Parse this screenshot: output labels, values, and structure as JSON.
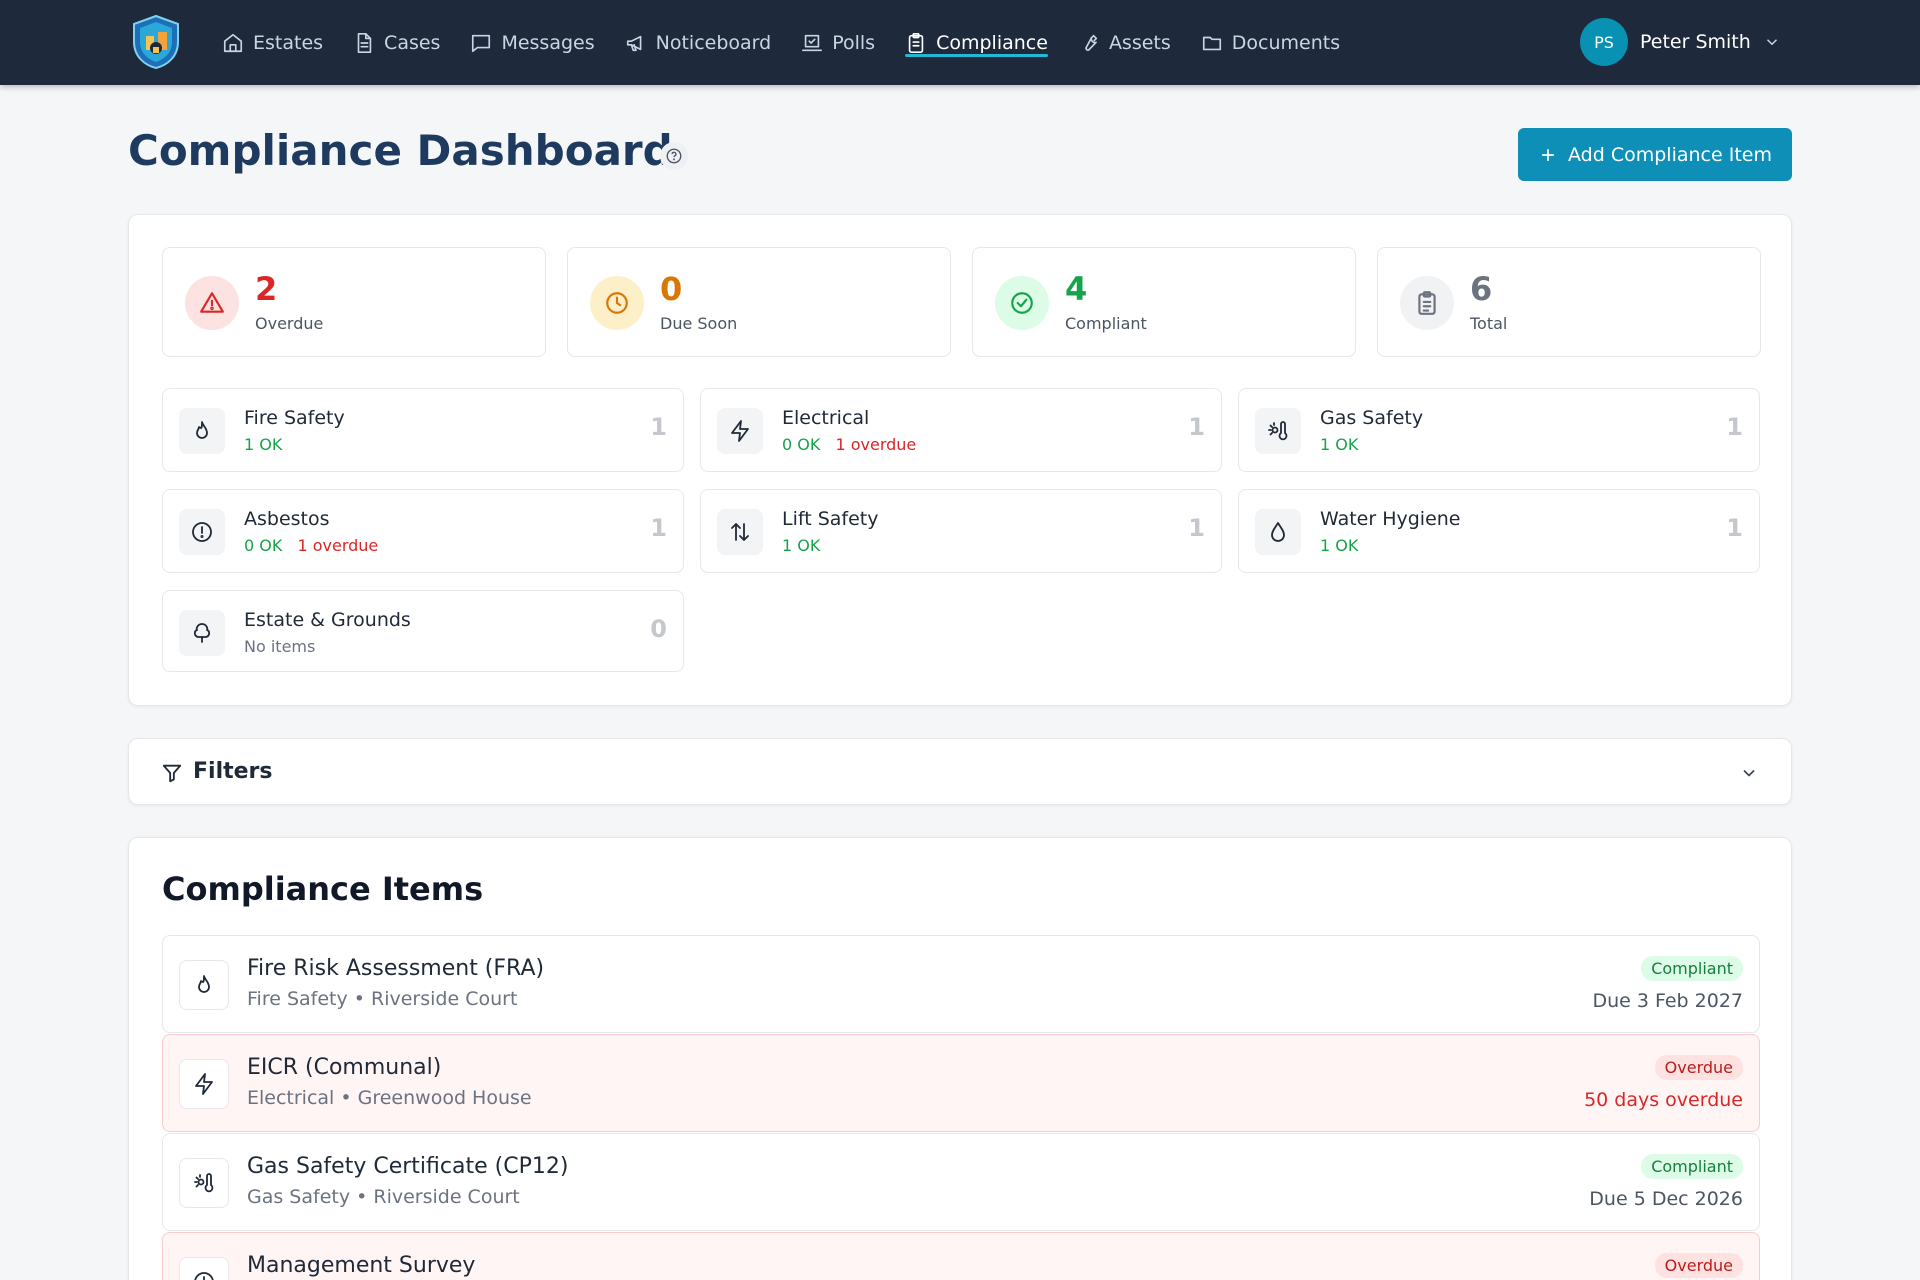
{
  "nav": {
    "items": [
      {
        "label": "Estates",
        "icon": "home-icon"
      },
      {
        "label": "Cases",
        "icon": "file-text-icon"
      },
      {
        "label": "Messages",
        "icon": "message-icon"
      },
      {
        "label": "Noticeboard",
        "icon": "megaphone-icon"
      },
      {
        "label": "Polls",
        "icon": "vote-icon"
      },
      {
        "label": "Compliance",
        "icon": "clipboard-icon",
        "active": true
      },
      {
        "label": "Assets",
        "icon": "wrench-icon"
      },
      {
        "label": "Documents",
        "icon": "folder-icon"
      }
    ],
    "user": {
      "initials": "PS",
      "name": "Peter Smith"
    },
    "accent": "#22b8d6"
  },
  "header": {
    "title": "Compliance Dashboard",
    "add_button": "Add Compliance Item"
  },
  "stats": [
    {
      "value": "2",
      "label": "Overdue",
      "color": "#dc2626",
      "bg": "#fde2e2",
      "icon": "alert-triangle-icon"
    },
    {
      "value": "0",
      "label": "Due Soon",
      "color": "#d97706",
      "bg": "#fdf0c8",
      "icon": "clock-icon"
    },
    {
      "value": "4",
      "label": "Compliant",
      "color": "#16a34a",
      "bg": "#dcfce7",
      "icon": "check-circle-icon"
    },
    {
      "value": "6",
      "label": "Total",
      "color": "#6b7280",
      "bg": "#f1f2f4",
      "icon": "clipboard-list-icon"
    }
  ],
  "categories": [
    {
      "name": "Fire Safety",
      "ok": "1 OK",
      "overdue": "",
      "count": "1",
      "icon": "flame-icon"
    },
    {
      "name": "Electrical",
      "ok": "0 OK",
      "overdue": "1 overdue",
      "count": "1",
      "icon": "zap-icon"
    },
    {
      "name": "Gas Safety",
      "ok": "1 OK",
      "overdue": "",
      "count": "1",
      "icon": "thermometer-sun-icon"
    },
    {
      "name": "Asbestos",
      "ok": "0 OK",
      "overdue": "1 overdue",
      "count": "1",
      "icon": "alert-circle-icon"
    },
    {
      "name": "Lift Safety",
      "ok": "1 OK",
      "overdue": "",
      "count": "1",
      "icon": "arrow-up-down-icon"
    },
    {
      "name": "Water Hygiene",
      "ok": "1 OK",
      "overdue": "",
      "count": "1",
      "icon": "droplet-icon"
    },
    {
      "name": "Estate & Grounds",
      "ok": "",
      "overdue": "",
      "none": "No items",
      "count": "0",
      "icon": "tree-icon"
    }
  ],
  "filters": {
    "title": "Filters"
  },
  "items_section": {
    "title": "Compliance Items",
    "items": [
      {
        "title": "Fire Risk Assessment (FRA)",
        "meta": "Fire Safety • Riverside Court",
        "status": "Compliant",
        "due": "Due 3 Feb 2027",
        "icon": "flame-icon"
      },
      {
        "title": "EICR (Communal)",
        "meta": "Electrical • Greenwood House",
        "status": "Overdue",
        "due": "50 days overdue",
        "icon": "zap-icon"
      },
      {
        "title": "Gas Safety Certificate (CP12)",
        "meta": "Gas Safety • Riverside Court",
        "status": "Compliant",
        "due": "Due 5 Dec 2026",
        "icon": "thermometer-sun-icon"
      },
      {
        "title": "Management Survey",
        "meta": "",
        "status": "Overdue",
        "due": "",
        "icon": "alert-circle-icon"
      }
    ]
  }
}
